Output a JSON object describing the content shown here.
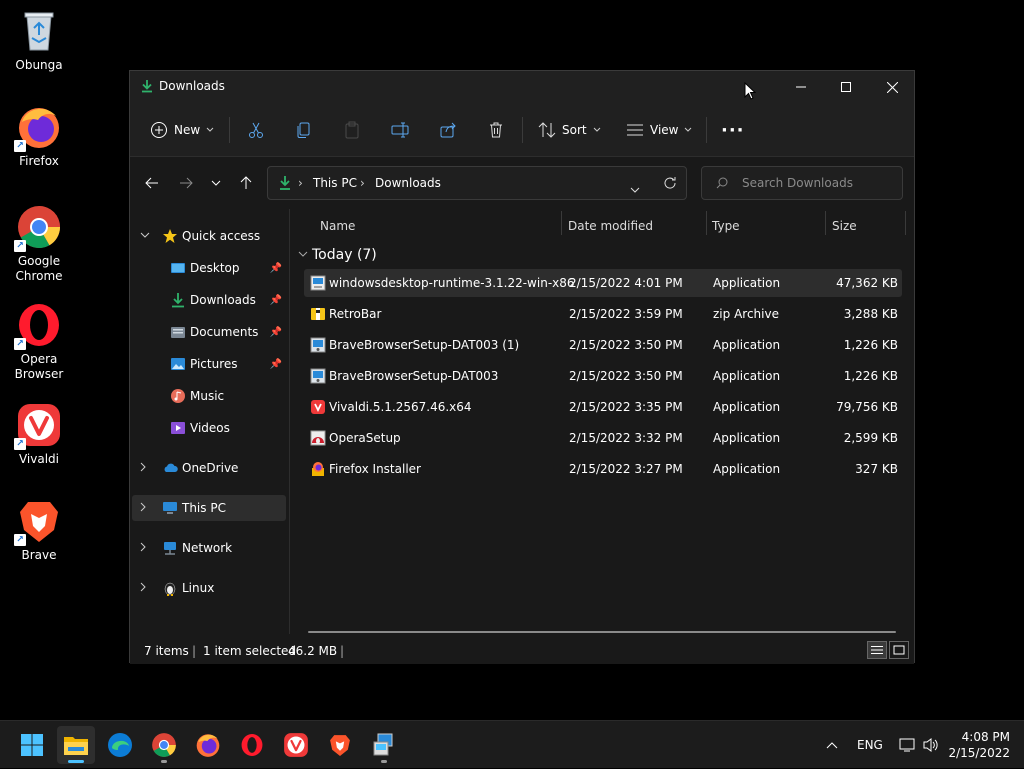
{
  "desktop_icons": [
    {
      "label_lines": [
        "Obunga"
      ],
      "icon": "recycle-bin-icon"
    },
    {
      "label_lines": [
        "Firefox"
      ],
      "icon": "firefox-icon"
    },
    {
      "label_lines": [
        "Google",
        "Chrome"
      ],
      "icon": "chrome-icon"
    },
    {
      "label_lines": [
        "Opera",
        "Browser"
      ],
      "icon": "opera-icon"
    },
    {
      "label_lines": [
        "Vivaldi"
      ],
      "icon": "vivaldi-icon"
    },
    {
      "label_lines": [
        "Brave"
      ],
      "icon": "brave-icon"
    }
  ],
  "window": {
    "title": "Downloads",
    "controls": {
      "minimize": "minimize-icon",
      "maximize": "maximize-icon",
      "close": "close-icon"
    }
  },
  "toolbar": {
    "new_label": "New",
    "sort_label": "Sort",
    "view_label": "View",
    "more_label": "···"
  },
  "address": {
    "crumbs": [
      "This PC",
      "Downloads"
    ],
    "search_placeholder": "Search Downloads"
  },
  "nav": {
    "quick_access": "Quick access",
    "items": [
      "Desktop",
      "Downloads",
      "Documents",
      "Pictures",
      "Music",
      "Videos"
    ],
    "onedrive": "OneDrive",
    "this_pc": "This PC",
    "network": "Network",
    "linux": "Linux"
  },
  "columns": {
    "name": "Name",
    "date": "Date modified",
    "type": "Type",
    "size": "Size"
  },
  "group_label": "Today (7)",
  "files": [
    {
      "name": "windowsdesktop-runtime-3.1.22-win-x86",
      "date": "2/15/2022 4:01 PM",
      "type": "Application",
      "size": "47,362 KB",
      "icon": "installer-icon",
      "selected": true
    },
    {
      "name": "RetroBar",
      "date": "2/15/2022 3:59 PM",
      "type": "zip Archive",
      "size": "3,288 KB",
      "icon": "zip-icon",
      "selected": false
    },
    {
      "name": "BraveBrowserSetup-DAT003 (1)",
      "date": "2/15/2022 3:50 PM",
      "type": "Application",
      "size": "1,226 KB",
      "icon": "setup-icon",
      "selected": false
    },
    {
      "name": "BraveBrowserSetup-DAT003",
      "date": "2/15/2022 3:50 PM",
      "type": "Application",
      "size": "1,226 KB",
      "icon": "setup-icon",
      "selected": false
    },
    {
      "name": "Vivaldi.5.1.2567.46.x64",
      "date": "2/15/2022 3:35 PM",
      "type": "Application",
      "size": "79,756 KB",
      "icon": "vivaldi-icon",
      "selected": false
    },
    {
      "name": "OperaSetup",
      "date": "2/15/2022 3:32 PM",
      "type": "Application",
      "size": "2,599 KB",
      "icon": "opera-setup-icon",
      "selected": false
    },
    {
      "name": "Firefox Installer",
      "date": "2/15/2022 3:27 PM",
      "type": "Application",
      "size": "327 KB",
      "icon": "firefox-installer-icon",
      "selected": false
    }
  ],
  "status": {
    "items": "7 items",
    "selected": "1 item selected",
    "size": "46.2 MB"
  },
  "taskbar": {
    "lang": "ENG",
    "time": "4:08 PM",
    "date": "2/15/2022"
  }
}
